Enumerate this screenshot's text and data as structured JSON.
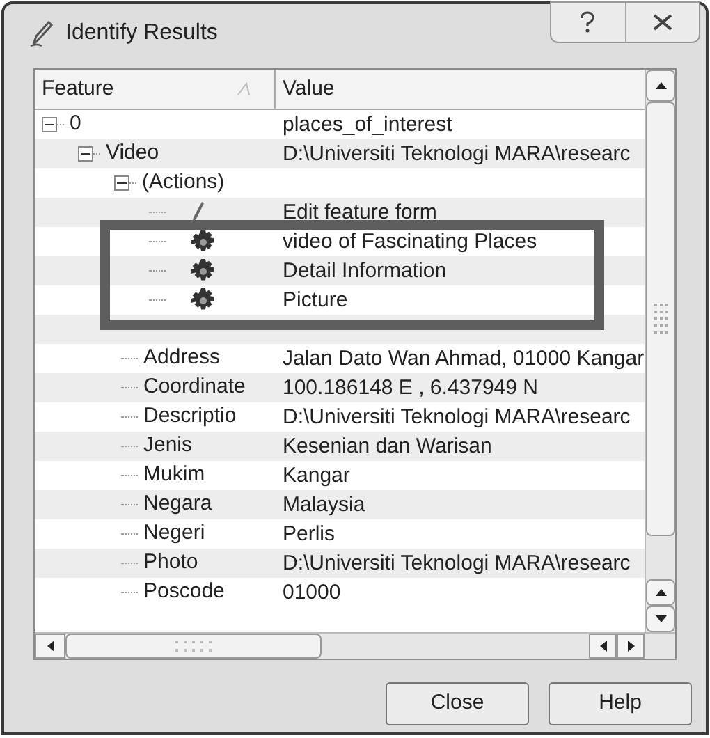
{
  "window": {
    "title": "Identify Results"
  },
  "columns": [
    {
      "label": "Feature",
      "sorted": true
    },
    {
      "label": "Value",
      "sorted": false
    }
  ],
  "tree": [
    {
      "kind": "group",
      "feature": "0",
      "value": "places_of_interest",
      "expanded": true,
      "children": [
        {
          "kind": "group",
          "feature": "Video",
          "value": "D:\\Universiti Teknologi MARA\\researc",
          "expanded": true,
          "children": [
            {
              "kind": "group",
              "feature": "(Actions)",
              "expanded": true,
              "children": [
                {
                  "kind": "edit",
                  "value": "Edit feature form"
                },
                {
                  "kind": "action",
                  "value": "video of Fascinating Places"
                },
                {
                  "kind": "action",
                  "value": "Detail Information"
                },
                {
                  "kind": "action",
                  "value": "Picture"
                }
              ]
            },
            {
              "kind": "group",
              "children": [
                {
                  "kind": "attribute",
                  "feature": "Address",
                  "value": "Jalan Dato Wan Ahmad, 01000 Kangar"
                },
                {
                  "kind": "attribute",
                  "feature": "Coordinate",
                  "value": "100.186148 E , 6.437949 N"
                },
                {
                  "kind": "attribute",
                  "feature": "Descriptio",
                  "value": "D:\\Universiti Teknologi MARA\\researc"
                },
                {
                  "kind": "attribute",
                  "feature": "Jenis",
                  "value": "Kesenian dan Warisan"
                },
                {
                  "kind": "attribute",
                  "feature": "Mukim",
                  "value": "Kangar"
                },
                {
                  "kind": "attribute",
                  "feature": "Negara",
                  "value": "Malaysia"
                },
                {
                  "kind": "attribute",
                  "feature": "Negeri",
                  "value": "Perlis"
                },
                {
                  "kind": "attribute",
                  "feature": "Photo",
                  "value": "D:\\Universiti Teknologi MARA\\researc"
                },
                {
                  "kind": "attribute",
                  "feature": "Poscode",
                  "value": "01000"
                }
              ]
            }
          ]
        }
      ]
    }
  ],
  "buttons": [
    "Close",
    "Help"
  ]
}
